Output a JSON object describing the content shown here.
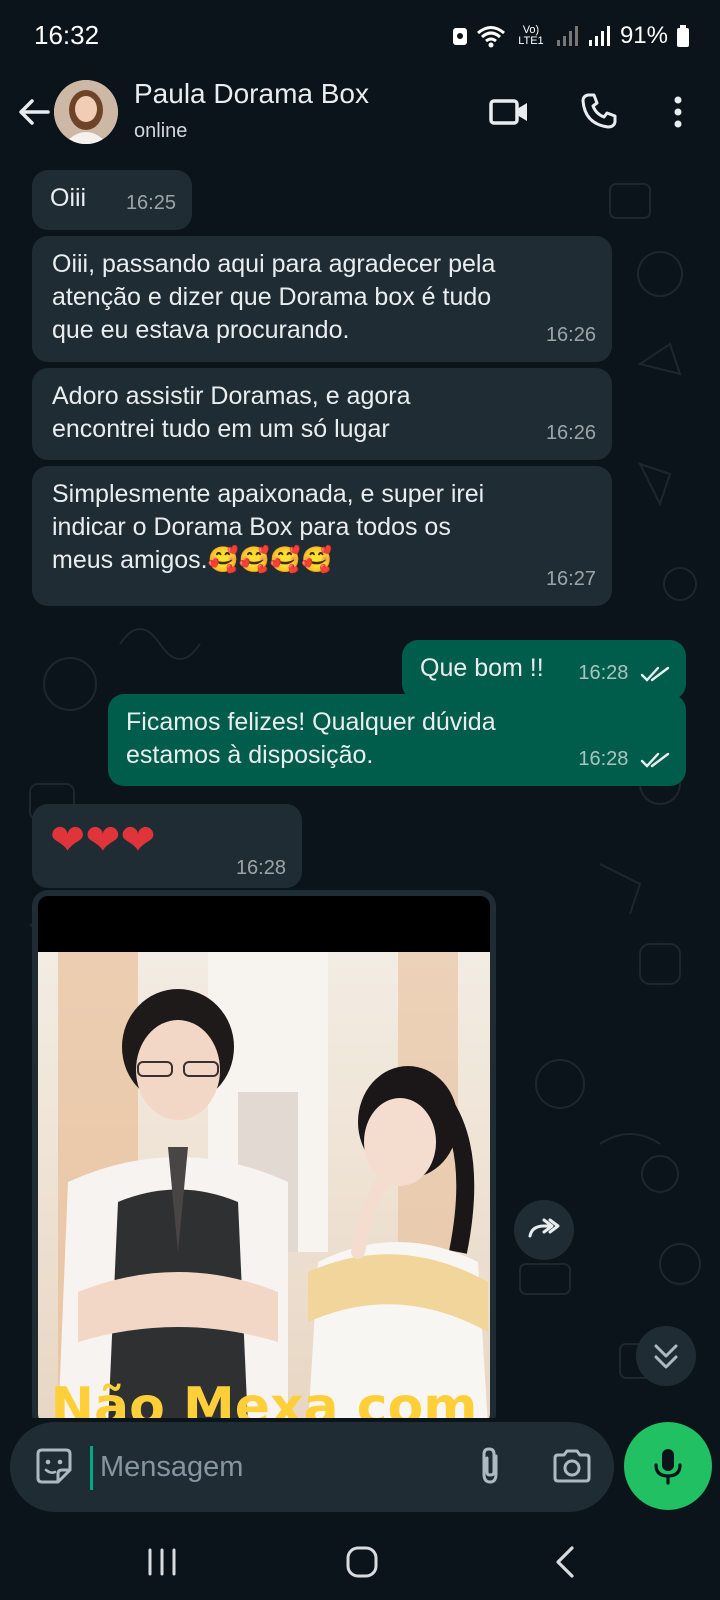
{
  "status_bar": {
    "time": "16:32",
    "battery": "91%",
    "network": "Vo) LTE1"
  },
  "header": {
    "contact_name": "Paula Dorama Box",
    "status": "online"
  },
  "messages": [
    {
      "direction": "in",
      "text": "Oiii",
      "time": "16:25"
    },
    {
      "direction": "in",
      "text": "Oiii, passando aqui para agradecer pela\natenção e dizer que Dorama box é tudo\nque eu estava procurando.",
      "time": "16:26"
    },
    {
      "direction": "in",
      "text": "Adoro assistir Doramas, e agora\nencontrei tudo em um só lugar",
      "time": "16:26"
    },
    {
      "direction": "in",
      "text": "Simplesmente apaixonada, e super irei\nindicar o Dorama Box para todos os\nmeus amigos.🥰🥰🥰🥰",
      "time": "16:27"
    },
    {
      "direction": "out",
      "text": "Que bom !!",
      "time": "16:28",
      "read": true
    },
    {
      "direction": "out",
      "text": "Ficamos felizes! Qualquer  dúvida\nestamos  à disposição.",
      "time": "16:28",
      "read": true
    },
    {
      "direction": "in",
      "text": "❤❤❤",
      "time": "16:28"
    }
  ],
  "image_message": {
    "direction": "in",
    "caption_partial": "Não Mexa com"
  },
  "composer": {
    "placeholder": "Mensagem"
  },
  "icons": {
    "back": "arrow-left-icon",
    "video": "video-call-icon",
    "phone": "phone-icon",
    "more": "more-vert-icon",
    "sticker": "sticker-icon",
    "attach": "paperclip-icon",
    "camera": "camera-icon",
    "mic": "mic-icon",
    "forward": "forward-icon",
    "scroll": "double-chevron-down-icon"
  },
  "colors": {
    "background": "#0b141a",
    "incoming": "#202c33",
    "outgoing": "#005c4b",
    "accent": "#21c063",
    "read_tick": "#e9edef"
  }
}
